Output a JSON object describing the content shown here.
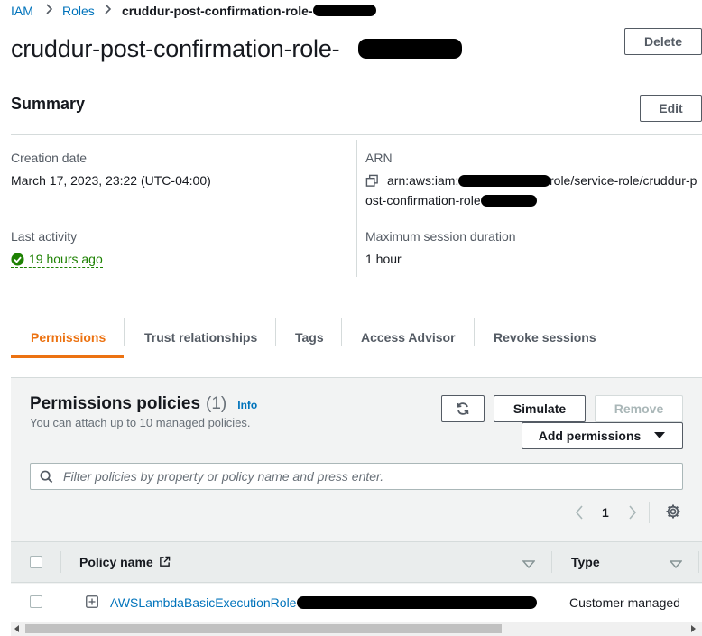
{
  "breadcrumb": {
    "items": [
      "IAM",
      "Roles"
    ],
    "current": "cruddur-post-confirmation-role-"
  },
  "header": {
    "title": "cruddur-post-confirmation-role-",
    "delete_label": "Delete"
  },
  "summary": {
    "heading": "Summary",
    "edit_label": "Edit",
    "creation_date_label": "Creation date",
    "creation_date_value": "March 17, 2023, 23:22 (UTC-04:00)",
    "last_activity_label": "Last activity",
    "last_activity_value": "19 hours ago",
    "arn_label": "ARN",
    "arn_prefix": "arn:aws:iam:",
    "arn_mid": "role/service-role/cruddur-p",
    "arn_line2": "ost-confirmation-role",
    "max_session_label": "Maximum session duration",
    "max_session_value": "1 hour"
  },
  "tabs": [
    {
      "label": "Permissions",
      "active": true
    },
    {
      "label": "Trust relationships",
      "active": false
    },
    {
      "label": "Tags",
      "active": false
    },
    {
      "label": "Access Advisor",
      "active": false
    },
    {
      "label": "Revoke sessions",
      "active": false
    }
  ],
  "permissions": {
    "title": "Permissions policies",
    "count": "(1)",
    "info_label": "Info",
    "subtitle": "You can attach up to 10 managed policies.",
    "simulate_label": "Simulate",
    "remove_label": "Remove",
    "add_label": "Add permissions",
    "search_placeholder": "Filter policies by property or policy name and press enter.",
    "page_number": "1",
    "columns": [
      "Policy name",
      "Type"
    ],
    "rows": [
      {
        "policy_name": "AWSLambdaBasicExecutionRole",
        "type": "Customer managed"
      }
    ]
  },
  "colors": {
    "link": "#0073bb",
    "active_tab": "#ec7211",
    "success": "#1d8102"
  }
}
